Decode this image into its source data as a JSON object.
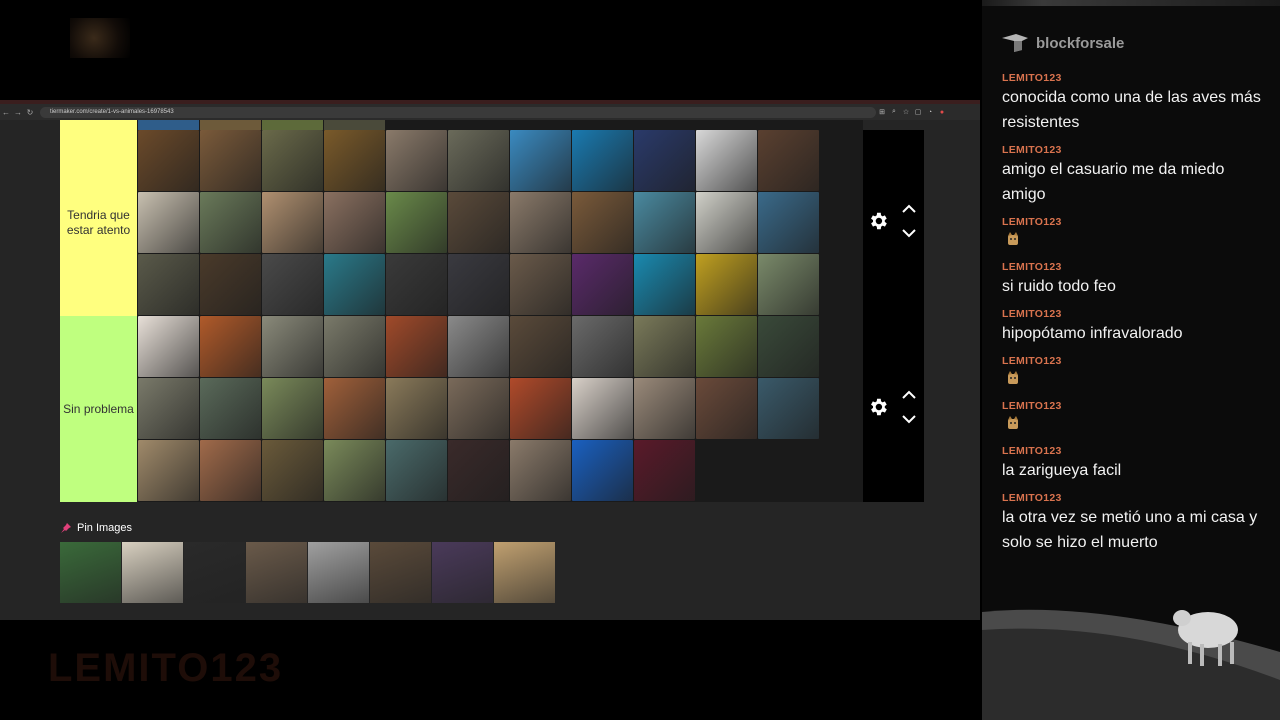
{
  "browser": {
    "url": "tiermaker.com/create/1-vs-animales-16978543",
    "nav": {
      "back": "←",
      "forward": "→",
      "reload": "↻"
    }
  },
  "tiers": [
    {
      "label": "Tendria que estar atento",
      "color": "#ffff7f"
    },
    {
      "label": "Sin problema",
      "color": "#bfff7f"
    }
  ],
  "pin_images": {
    "label": "Pin Images"
  },
  "chat": {
    "brand": "blockforsale",
    "messages": [
      {
        "user": "LEMITO123",
        "text": "conocida como una de las aves más resistentes"
      },
      {
        "user": "LEMITO123",
        "text": "amigo el casuario me da miedo amigo"
      },
      {
        "user": "LEMITO123",
        "text": "",
        "emote": "cat-emote-icon"
      },
      {
        "user": "LEMITO123",
        "text": "si ruido todo feo"
      },
      {
        "user": "LEMITO123",
        "text": "hipopótamo infravalorado"
      },
      {
        "user": "LEMITO123",
        "text": "",
        "emote": "cat-emote-icon"
      },
      {
        "user": "LEMITO123",
        "text": "",
        "emote": "cat-emote-icon"
      },
      {
        "user": "LEMITO123",
        "text": "la zarigueya facil"
      },
      {
        "user": "LEMITO123",
        "text": "la otra vez se metió uno a mi casa y solo se hizo el muerto"
      }
    ]
  },
  "watermark": "LEMITO123",
  "colors": {
    "chat_username": "#d9734e",
    "tier_a": "#ffff7f",
    "tier_b": "#bfff7f",
    "page_bg": "#252525"
  }
}
